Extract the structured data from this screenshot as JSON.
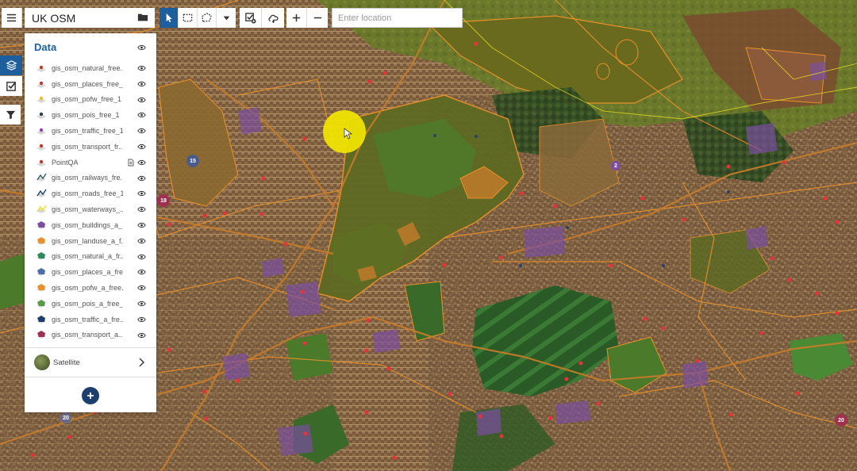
{
  "app": {
    "project_title": "UK OSM"
  },
  "location_search": {
    "placeholder": "Enter location"
  },
  "panel": {
    "title": "Data",
    "layers": [
      {
        "label": "gis_osm_natural_free...",
        "icon": "point-layer-icon",
        "color": "#c0392b"
      },
      {
        "label": "gis_osm_places_free_1",
        "icon": "point-layer-icon",
        "color": "#c0392b"
      },
      {
        "label": "gis_osm_pofw_free_1",
        "icon": "point-layer-icon",
        "color": "#e8c020"
      },
      {
        "label": "gis_osm_pois_free_1",
        "icon": "point-layer-icon",
        "color": "#2c3e50"
      },
      {
        "label": "gis_osm_traffic_free_1",
        "icon": "point-layer-icon",
        "color": "#8e44ad"
      },
      {
        "label": "gis_osm_transport_fr...",
        "icon": "point-layer-icon",
        "color": "#c0392b"
      },
      {
        "label": "PointQA",
        "icon": "point-layer-icon",
        "color": "#c0392b"
      },
      {
        "label": "gis_osm_railways_fre...",
        "icon": "line-layer-icon",
        "color": "#2c5e5e"
      },
      {
        "label": "gis_osm_roads_free_1",
        "icon": "line-layer-icon",
        "color": "#1c3f6e"
      },
      {
        "label": "gis_osm_waterways_...",
        "icon": "line-layer-icon",
        "color": "#e8e020"
      },
      {
        "label": "gis_osm_buildings_a_...",
        "icon": "polygon-layer-icon",
        "color": "#7b4ea0"
      },
      {
        "label": "gis_osm_landuse_a_f...",
        "icon": "polygon-layer-icon",
        "color": "#e8902a"
      },
      {
        "label": "gis_osm_natural_a_fr...",
        "icon": "polygon-layer-icon",
        "color": "#2e8b57"
      },
      {
        "label": "gis_osm_places_a_fre...",
        "icon": "polygon-layer-icon",
        "color": "#4a6fa5"
      },
      {
        "label": "gis_osm_pofw_a_free...",
        "icon": "polygon-layer-icon",
        "color": "#e8902a"
      },
      {
        "label": "gis_osm_pois_a_free_1",
        "icon": "polygon-layer-icon",
        "color": "#5a9a4a"
      },
      {
        "label": "gis_osm_traffic_a_fre...",
        "icon": "polygon-layer-icon",
        "color": "#1c3f6e"
      },
      {
        "label": "gis_osm_transport_a...",
        "icon": "polygon-layer-icon",
        "color": "#a03050"
      }
    ],
    "basemap": {
      "label": "Satellite"
    }
  },
  "map": {
    "clusters": [
      "15",
      "18",
      "2",
      "20",
      "20"
    ]
  },
  "colors": {
    "accent": "#1c5f9c",
    "add_button": "#1c3f6e",
    "highlight": "#f2e600",
    "landuse_outline": "#e8902a",
    "point_marker": "#e8313a"
  }
}
